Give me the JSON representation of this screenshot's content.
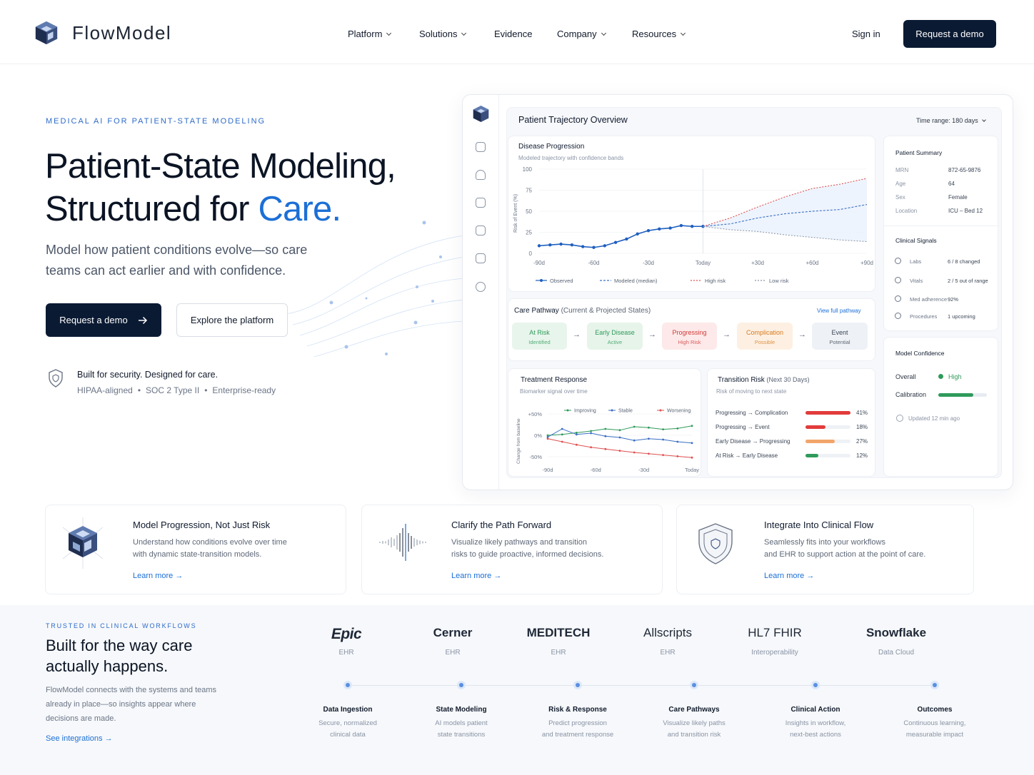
{
  "header": {
    "brand": "FlowModel",
    "nav": [
      {
        "label": "Platform",
        "has_menu": true
      },
      {
        "label": "Solutions",
        "has_menu": true
      },
      {
        "label": "Evidence",
        "has_menu": false
      },
      {
        "label": "Company",
        "has_menu": true
      },
      {
        "label": "Resources",
        "has_menu": true
      }
    ],
    "sign_in": "Sign in",
    "cta": "Request a demo"
  },
  "hero": {
    "eyebrow": "MEDICAL AI FOR PATIENT-STATE MODELING",
    "title_line1": "Patient-State Modeling,",
    "title_line2_prefix": "Structured for ",
    "title_line2_accent": "Care.",
    "subtitle": "Model how patient conditions evolve—so care teams can act earlier and with confidence.",
    "primary_cta": "Request a demo",
    "secondary_cta": "Explore the platform",
    "security_title": "Built for security. Designed for care.",
    "security_items": [
      "HIPAA-aligned",
      "SOC 2 Type II",
      "Enterprise-ready"
    ]
  },
  "dashboard": {
    "title": "Patient Trajectory Overview",
    "time_range": "Time range: 180 days",
    "rail_icons": [
      "home-icon",
      "user-icon",
      "chart-icon",
      "monitor-icon",
      "clipboard-icon",
      "shield-icon"
    ],
    "disease": {
      "title": "Disease Progression",
      "subtitle": "Modeled trajectory with confidence bands",
      "ylabel": "Risk of Event (%)",
      "legend": [
        "Observed",
        "Modeled (median)",
        "High risk",
        "Low risk"
      ]
    },
    "pathway": {
      "title": "Care Pathway",
      "title_note": "(Current & Projected States)",
      "link": "View full pathway",
      "states": [
        {
          "name": "At Risk",
          "status": "Identified",
          "color": "#2f9a5a",
          "bg": "#e8f5ec"
        },
        {
          "name": "Early Disease",
          "status": "Active",
          "color": "#2f9a5a",
          "bg": "#e6f4ea"
        },
        {
          "name": "Progressing",
          "status": "High Risk",
          "color": "#d03a3a",
          "bg": "#fde9e9"
        },
        {
          "name": "Complication",
          "status": "Possible",
          "color": "#d77a1f",
          "bg": "#fdf0e2"
        },
        {
          "name": "Event",
          "status": "Potential",
          "color": "#3b4656",
          "bg": "#eef1f5"
        }
      ]
    },
    "treatment": {
      "title": "Treatment Response",
      "subtitle": "Biomarker signal over time",
      "ylabel": "Change from baseline",
      "legend": [
        "Improving",
        "Stable",
        "Worsening"
      ]
    },
    "transition": {
      "title": "Transition Risk",
      "title_note": "(Next 30 Days)",
      "subtitle": "Risk of moving to next state",
      "rows": [
        {
          "from": "Progressing",
          "to": "Complication",
          "value": 0.41,
          "label": "41%",
          "color": "#e23b3b"
        },
        {
          "from": "Progressing",
          "to": "Event",
          "value": 0.18,
          "label": "18%",
          "color": "#e23b3b"
        },
        {
          "from": "Early Disease",
          "to": "Progressing",
          "value": 0.27,
          "label": "27%",
          "color": "#f2a56b"
        },
        {
          "from": "At Risk",
          "to": "Early Disease",
          "value": 0.12,
          "label": "12%",
          "color": "#2f9a5a"
        }
      ]
    },
    "summary": {
      "title": "Patient Summary",
      "rows": [
        {
          "k": "MRN",
          "v": "872-65-9876"
        },
        {
          "k": "Age",
          "v": "64"
        },
        {
          "k": "Sex",
          "v": "Female"
        },
        {
          "k": "Location",
          "v": "ICU – Bed 12"
        }
      ]
    },
    "signals": {
      "title": "Clinical Signals",
      "rows": [
        {
          "k": "Labs",
          "v": "6 / 8 changed",
          "icon": "flask-icon"
        },
        {
          "k": "Vitals",
          "v": "2 / 5 out of range",
          "icon": "heart-icon"
        },
        {
          "k": "Med adherence",
          "v": "92%",
          "icon": "pill-icon"
        },
        {
          "k": "Procedures",
          "v": "1 upcoming",
          "icon": "clock-icon"
        }
      ]
    },
    "confidence": {
      "title": "Model Confidence",
      "overall_label": "Overall",
      "overall_value": "High",
      "calibration_label": "Calibration",
      "calibration_value": 0.72,
      "updated": "Updated 12 min ago"
    }
  },
  "features": [
    {
      "title": "Model Progression, Not Just Risk",
      "desc_line1": "Understand how conditions evolve over time",
      "desc_line2": "with dynamic state-transition models.",
      "link": "Learn more",
      "icon": "cube-icon"
    },
    {
      "title": "Clarify the Path Forward",
      "desc_line1": "Visualize likely pathways and transition",
      "desc_line2": "risks to guide proactive, informed decisions.",
      "link": "Learn more",
      "icon": "waveform-icon"
    },
    {
      "title": "Integrate Into Clinical Flow",
      "desc_line1": "Seamlessly fits into your workflows",
      "desc_line2": "and EHR to support action at the point of care.",
      "link": "Learn more",
      "icon": "shield-icon"
    }
  ],
  "integrations": {
    "eyebrow": "TRUSTED IN CLINICAL WORKFLOWS",
    "title_line1": "Built for the way care",
    "title_line2": "actually happens.",
    "desc": "FlowModel connects with the systems and teams already in place—so insights appear where decisions are made.",
    "link": "See integrations",
    "partners": [
      {
        "name": "Epic",
        "label": "EHR"
      },
      {
        "name": "Cerner",
        "label": "EHR"
      },
      {
        "name": "MEDITECH",
        "label": "EHR"
      },
      {
        "name": "Allscripts",
        "label": "EHR"
      },
      {
        "name": "HL7 FHIR",
        "label": "Interoperability"
      },
      {
        "name": "Snowflake",
        "label": "Data Cloud"
      }
    ],
    "steps": [
      {
        "title": "Data Ingestion",
        "line1": "Secure, normalized",
        "line2": "clinical data"
      },
      {
        "title": "State Modeling",
        "line1": "AI models patient",
        "line2": "state transitions"
      },
      {
        "title": "Risk & Response",
        "line1": "Predict progression",
        "line2": "and treatment response"
      },
      {
        "title": "Care Pathways",
        "line1": "Visualize likely paths",
        "line2": "and transition risk"
      },
      {
        "title": "Clinical Action",
        "line1": "Insights in workflow,",
        "line2": "next-best actions"
      },
      {
        "title": "Outcomes",
        "line1": "Continuous learning,",
        "line2": "measurable impact"
      }
    ]
  },
  "chart_data": [
    {
      "type": "line",
      "title": "Disease Progression",
      "ylabel": "Risk of Event (%)",
      "x_ticks": [
        "-90d",
        "-60d",
        "-30d",
        "Today",
        "+30d",
        "+60d",
        "+90d"
      ],
      "y_ticks": [
        0,
        25,
        50,
        75,
        100
      ],
      "ylim": [
        0,
        100
      ],
      "series": [
        {
          "name": "Observed",
          "x": [
            -90,
            -84,
            -78,
            -72,
            -66,
            -60,
            -54,
            -48,
            -42,
            -36,
            -30,
            -24,
            -18,
            -12,
            -6,
            0
          ],
          "y": [
            9,
            10,
            11,
            10,
            8,
            7,
            9,
            13,
            17,
            23,
            27,
            29,
            30,
            33,
            32,
            32
          ]
        },
        {
          "name": "Modeled (median)",
          "x": [
            0,
            15,
            30,
            45,
            60,
            75,
            90
          ],
          "y": [
            32,
            35,
            42,
            47,
            50,
            52,
            58
          ]
        },
        {
          "name": "High risk",
          "x": [
            0,
            15,
            30,
            45,
            60,
            75,
            90
          ],
          "y": [
            32,
            42,
            55,
            67,
            77,
            82,
            89
          ]
        },
        {
          "name": "Low risk",
          "x": [
            0,
            15,
            30,
            45,
            60,
            75,
            90
          ],
          "y": [
            32,
            28,
            26,
            22,
            19,
            16,
            14
          ]
        }
      ]
    },
    {
      "type": "line",
      "title": "Treatment Response",
      "ylabel": "Change from baseline",
      "x_ticks": [
        "-90d",
        "-60d",
        "-30d",
        "Today"
      ],
      "y_ticks": [
        "+50%",
        "0%",
        "-50%"
      ],
      "ylim": [
        -60,
        60
      ],
      "series": [
        {
          "name": "Improving",
          "x": [
            -90,
            -81,
            -72,
            -63,
            -54,
            -45,
            -36,
            -27,
            -18,
            -9,
            0
          ],
          "y": [
            0,
            2,
            6,
            10,
            15,
            12,
            20,
            18,
            14,
            16,
            22
          ]
        },
        {
          "name": "Stable",
          "x": [
            -90,
            -81,
            -72,
            -63,
            -54,
            -45,
            -36,
            -27,
            -18,
            -9,
            0
          ],
          "y": [
            -4,
            15,
            2,
            5,
            -2,
            -5,
            -12,
            -8,
            -10,
            -15,
            -18
          ]
        },
        {
          "name": "Worsening",
          "x": [
            -90,
            -81,
            -72,
            -63,
            -54,
            -45,
            -36,
            -27,
            -18,
            -9,
            0
          ],
          "y": [
            -8,
            -15,
            -22,
            -28,
            -32,
            -36,
            -40,
            -43,
            -46,
            -49,
            -52
          ]
        }
      ]
    }
  ]
}
